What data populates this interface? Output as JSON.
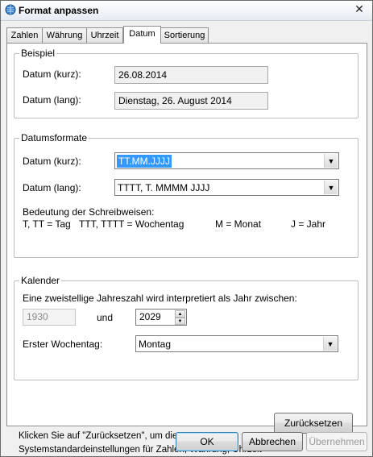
{
  "window": {
    "title": "Format anpassen",
    "close_glyph": "✕"
  },
  "tabs": [
    {
      "label": "Zahlen"
    },
    {
      "label": "Währung"
    },
    {
      "label": "Uhrzeit"
    },
    {
      "label": "Datum",
      "active": true
    },
    {
      "label": "Sortierung"
    }
  ],
  "beispiel": {
    "title": "Beispiel",
    "short_label": "Datum (kurz):",
    "short_value": "26.08.2014",
    "long_label": "Datum (lang):",
    "long_value": "Dienstag, 26. August 2014"
  },
  "datumsformate": {
    "title": "Datumsformate",
    "short_label": "Datum (kurz):",
    "short_value": "TT.MM.JJJJ",
    "long_label": "Datum (lang):",
    "long_value": "TTTT, T. MMMM JJJJ",
    "legend_title": "Bedeutung der Schreibweisen:",
    "legend_day": "T, TT = Tag",
    "legend_weekday": "TTT, TTTT = Wochentag",
    "legend_month": "M = Monat",
    "legend_year": "J = Jahr"
  },
  "kalender": {
    "title": "Kalender",
    "description": "Eine zweistellige Jahreszahl wird interpretiert als Jahr zwischen:",
    "year_from": "1930",
    "and_label": "und",
    "year_to": "2029",
    "first_weekday_label": "Erster Wochentag:",
    "first_weekday_value": "Montag"
  },
  "reset": {
    "note": "Klicken Sie auf \"Zurücksetzen\", um die Systemstandardeinstellungen für Zahlen, Währung, Uhrzeit und Datum wiederherzustellen.",
    "button": "Zurücksetzen"
  },
  "footer": {
    "ok": "OK",
    "cancel": "Abbrechen",
    "apply": "Übernehmen"
  },
  "icons": {
    "app": "globe-clock-icon",
    "dropdown": "chevron-down-icon"
  },
  "colors": {
    "selection": "#3399ff",
    "default_button_border": "#3c7fb1"
  }
}
